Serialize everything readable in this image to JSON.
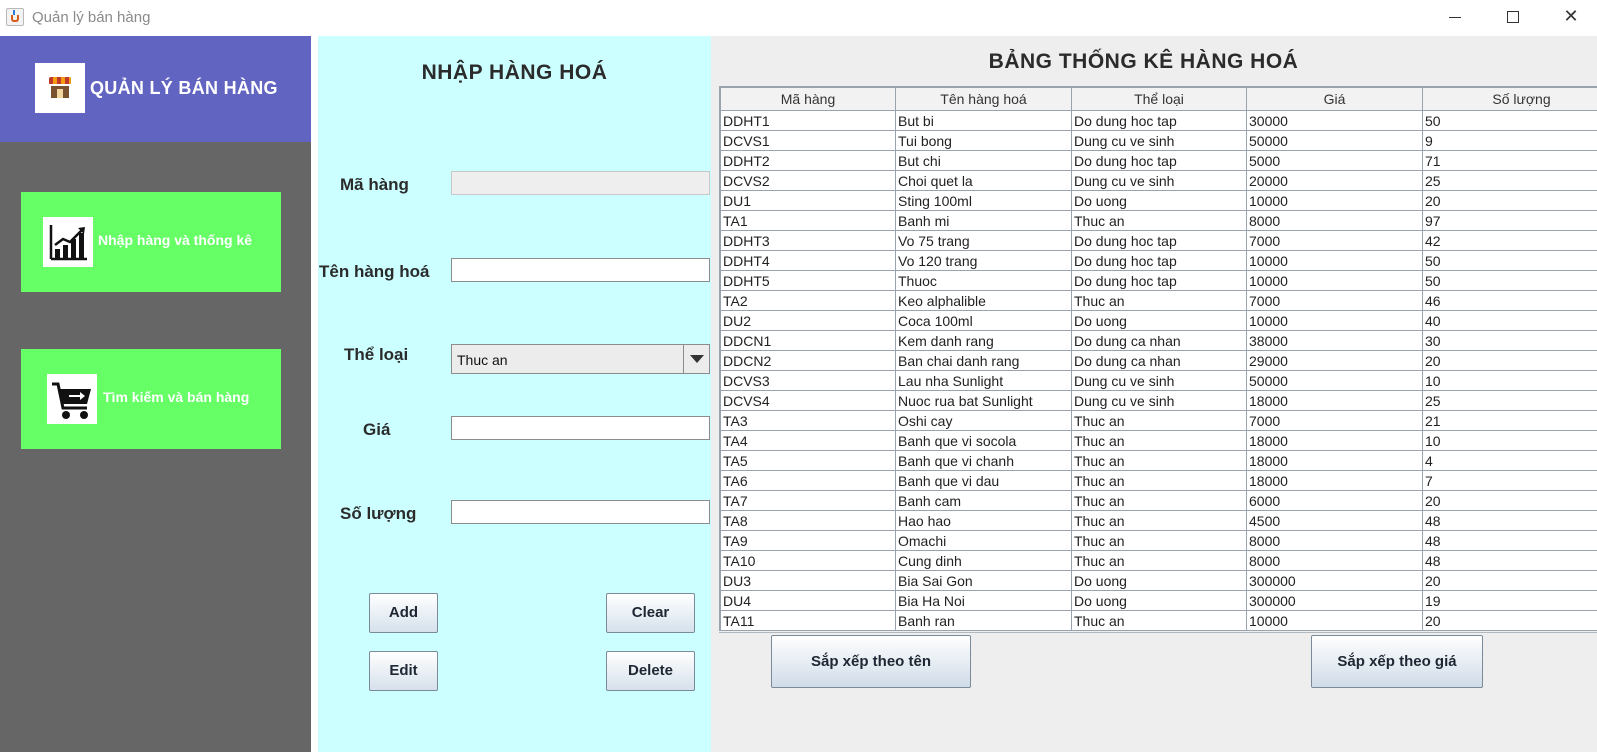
{
  "window": {
    "title": "Quản lý bán hàng"
  },
  "sidebar": {
    "brand": "QUẢN LÝ BÁN HÀNG",
    "items": [
      {
        "label": "Nhập hàng và thống kê",
        "icon": "chart-icon"
      },
      {
        "label": "Tìm kiếm và bán hàng",
        "icon": "cart-icon"
      }
    ]
  },
  "form": {
    "title": "NHẬP HÀNG HOÁ",
    "fields": {
      "ma_hang": {
        "label": "Mã hàng",
        "value": ""
      },
      "ten_hang": {
        "label": "Tên hàng hoá",
        "value": ""
      },
      "the_loai": {
        "label": "Thể loại",
        "value": "Thuc an"
      },
      "gia": {
        "label": "Giá",
        "value": ""
      },
      "so_luong": {
        "label": "Số lượng",
        "value": ""
      }
    },
    "buttons": {
      "add": "Add",
      "clear": "Clear",
      "edit": "Edit",
      "delete": "Delete"
    }
  },
  "table": {
    "title": "BẢNG THỐNG KÊ HÀNG HOÁ",
    "columns": [
      "Mã hàng",
      "Tên hàng hoá",
      "Thể loại",
      "Giá",
      "Số lượng"
    ],
    "rows": [
      [
        "DDHT1",
        "But bi",
        "Do dung hoc tap",
        "30000",
        "50"
      ],
      [
        "DCVS1",
        "Tui bong",
        "Dung cu ve sinh",
        "50000",
        "9"
      ],
      [
        "DDHT2",
        "But chi",
        "Do dung hoc tap",
        "5000",
        "71"
      ],
      [
        "DCVS2",
        "Choi quet la",
        "Dung cu ve sinh",
        "20000",
        "25"
      ],
      [
        "DU1",
        "Sting 100ml",
        "Do uong",
        "10000",
        "20"
      ],
      [
        "TA1",
        "Banh mi",
        "Thuc an",
        "8000",
        "97"
      ],
      [
        "DDHT3",
        "Vo 75 trang",
        "Do dung hoc tap",
        "7000",
        "42"
      ],
      [
        "DDHT4",
        "Vo 120 trang",
        "Do dung hoc tap",
        "10000",
        "50"
      ],
      [
        "DDHT5",
        "Thuoc",
        "Do dung hoc tap",
        "10000",
        "50"
      ],
      [
        "TA2",
        "Keo alphalible",
        "Thuc an",
        "7000",
        "46"
      ],
      [
        "DU2",
        "Coca 100ml",
        "Do uong",
        "10000",
        "40"
      ],
      [
        "DDCN1",
        "Kem danh rang",
        "Do dung ca nhan",
        "38000",
        "30"
      ],
      [
        "DDCN2",
        "Ban chai danh rang",
        "Do dung ca nhan",
        "29000",
        "20"
      ],
      [
        "DCVS3",
        "Lau nha Sunlight",
        "Dung cu ve sinh",
        "50000",
        "10"
      ],
      [
        "DCVS4",
        "Nuoc rua bat Sunlight",
        "Dung cu ve sinh",
        "18000",
        "25"
      ],
      [
        "TA3",
        "Oshi cay",
        "Thuc an",
        "7000",
        "21"
      ],
      [
        "TA4",
        "Banh que vi socola",
        "Thuc an",
        "18000",
        "10"
      ],
      [
        "TA5",
        "Banh que vi chanh",
        "Thuc an",
        "18000",
        "4"
      ],
      [
        "TA6",
        "Banh que vi dau",
        "Thuc an",
        "18000",
        "7"
      ],
      [
        "TA7",
        "Banh cam",
        "Thuc an",
        "6000",
        "20"
      ],
      [
        "TA8",
        "Hao hao",
        "Thuc an",
        "4500",
        "48"
      ],
      [
        "TA9",
        "Omachi",
        "Thuc an",
        "8000",
        "48"
      ],
      [
        "TA10",
        "Cung dinh",
        "Thuc an",
        "8000",
        "48"
      ],
      [
        "DU3",
        "Bia Sai Gon",
        "Do uong",
        "300000",
        "20"
      ],
      [
        "DU4",
        "Bia Ha Noi",
        "Do uong",
        "300000",
        "19"
      ],
      [
        "TA11",
        "Banh ran",
        "Thuc an",
        "10000",
        "20"
      ]
    ],
    "sort_buttons": {
      "by_name": "Sắp xếp theo tên",
      "by_price": "Sắp xếp theo giá"
    }
  }
}
